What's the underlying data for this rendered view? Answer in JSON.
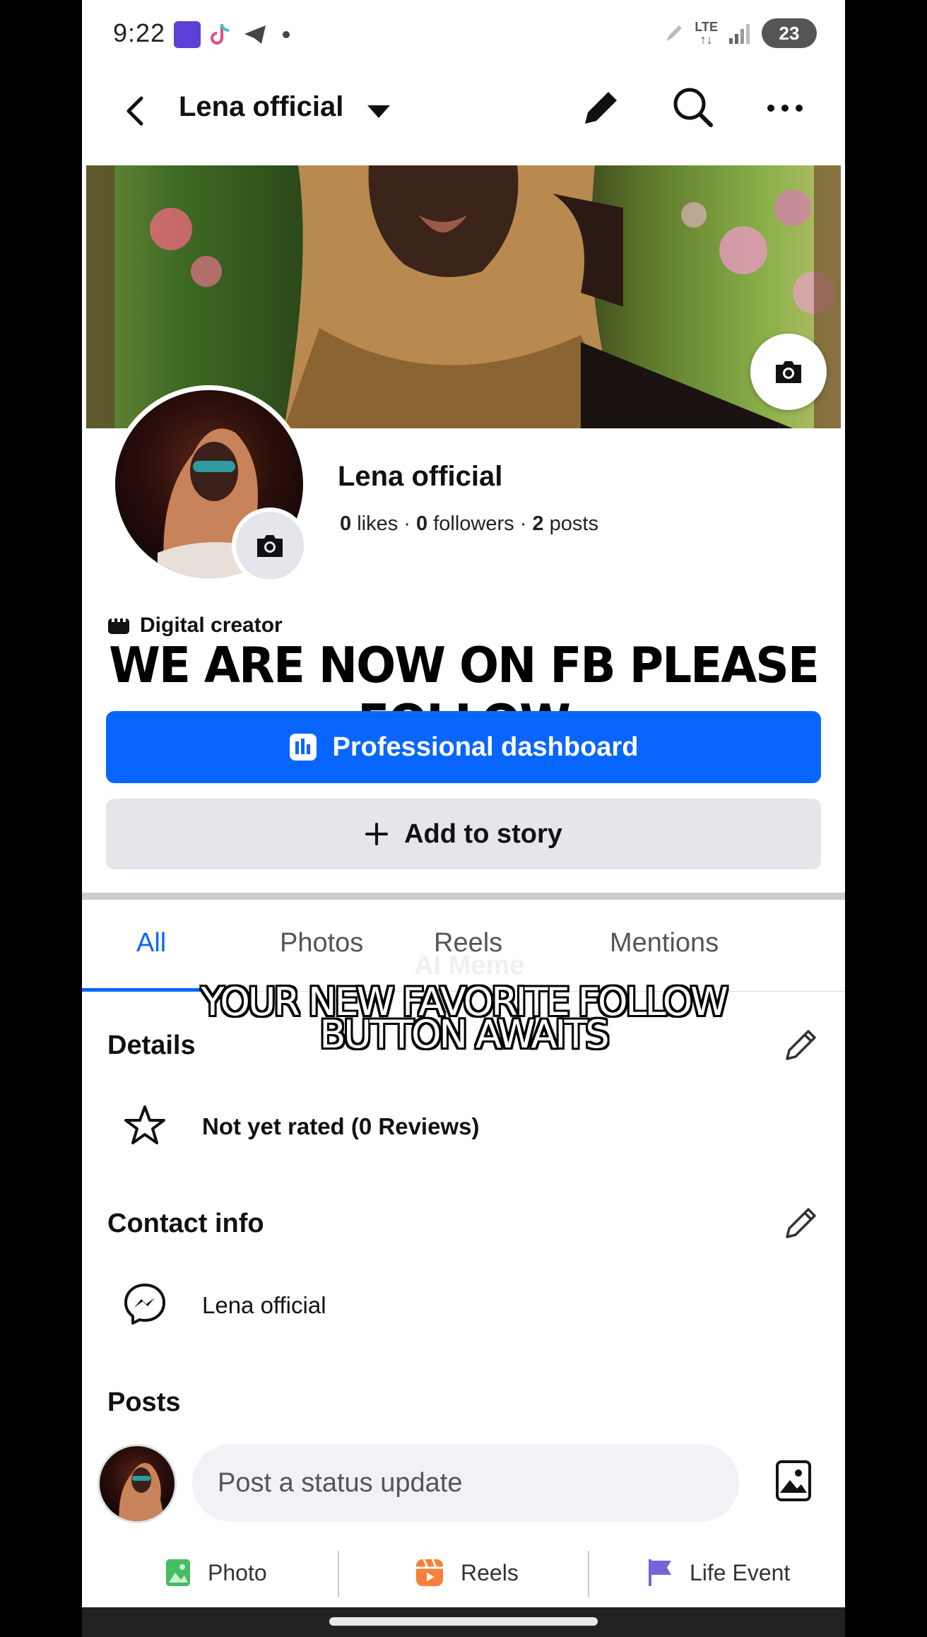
{
  "status_bar": {
    "time": "9:22",
    "network": "LTE",
    "battery": "23",
    "app_icons": [
      "football-app-icon",
      "tiktok-icon",
      "telegram-icon",
      "dot-icon"
    ]
  },
  "top_bar": {
    "title": "Lena official"
  },
  "profile": {
    "name": "Lena official",
    "stats": {
      "likes_count": "0",
      "likes_label": "likes",
      "followers_count": "0",
      "followers_label": "followers",
      "posts_count": "2",
      "posts_label": "posts"
    },
    "category": "Digital creator",
    "bio": "WE ARE NOW ON FB PLEASE FOLLOW"
  },
  "buttons": {
    "professional_dashboard": "Professional dashboard",
    "add_to_story": "Add to story"
  },
  "tabs": [
    {
      "label": "All",
      "active": true
    },
    {
      "label": "Photos",
      "active": false
    },
    {
      "label": "Reels",
      "active": false
    },
    {
      "label": "Mentions",
      "active": false
    }
  ],
  "tab_ghost_text": "AI Meme",
  "overlay_caption": {
    "line1": "YOUR NEW FAVORITE FOLLOW",
    "line2": "BUTTON AWAITS"
  },
  "details": {
    "title": "Details",
    "rating": "Not yet rated (0 Reviews)"
  },
  "contact_info": {
    "title": "Contact info",
    "messenger": "Lena official"
  },
  "posts": {
    "title": "Posts",
    "composer_placeholder": "Post a status update",
    "actions": [
      {
        "label": "Photo",
        "icon": "photo-icon",
        "color": "#45bd62"
      },
      {
        "label": "Reels",
        "icon": "reels-icon",
        "color": "#f7803a"
      },
      {
        "label": "Life Event",
        "icon": "flag-icon",
        "color": "#7b61d9"
      }
    ]
  },
  "colors": {
    "accent": "#0866ff",
    "secondary_button": "#e4e6eb"
  }
}
